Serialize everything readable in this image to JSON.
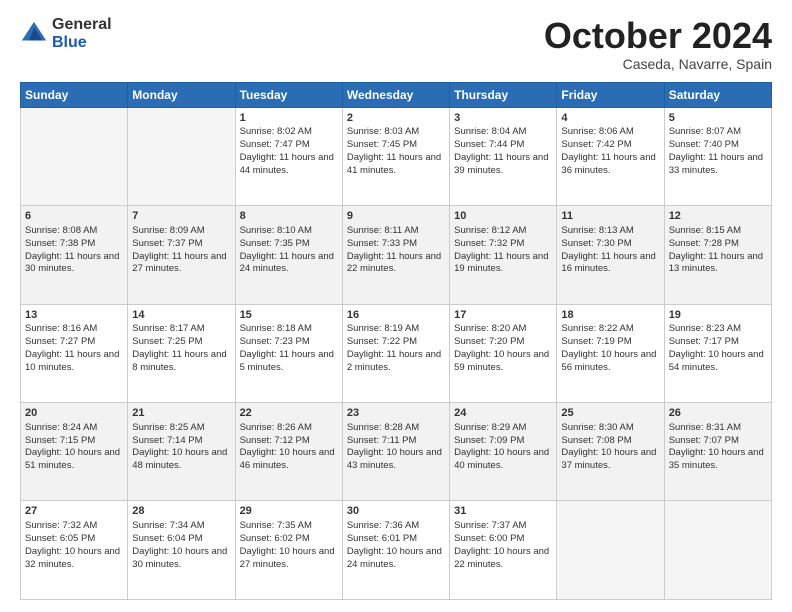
{
  "header": {
    "logo_general": "General",
    "logo_blue": "Blue",
    "month_title": "October 2024",
    "location": "Caseda, Navarre, Spain"
  },
  "weekdays": [
    "Sunday",
    "Monday",
    "Tuesday",
    "Wednesday",
    "Thursday",
    "Friday",
    "Saturday"
  ],
  "weeks": [
    [
      {
        "day": "",
        "sunrise": "",
        "sunset": "",
        "daylight": ""
      },
      {
        "day": "",
        "sunrise": "",
        "sunset": "",
        "daylight": ""
      },
      {
        "day": "1",
        "sunrise": "Sunrise: 8:02 AM",
        "sunset": "Sunset: 7:47 PM",
        "daylight": "Daylight: 11 hours and 44 minutes."
      },
      {
        "day": "2",
        "sunrise": "Sunrise: 8:03 AM",
        "sunset": "Sunset: 7:45 PM",
        "daylight": "Daylight: 11 hours and 41 minutes."
      },
      {
        "day": "3",
        "sunrise": "Sunrise: 8:04 AM",
        "sunset": "Sunset: 7:44 PM",
        "daylight": "Daylight: 11 hours and 39 minutes."
      },
      {
        "day": "4",
        "sunrise": "Sunrise: 8:06 AM",
        "sunset": "Sunset: 7:42 PM",
        "daylight": "Daylight: 11 hours and 36 minutes."
      },
      {
        "day": "5",
        "sunrise": "Sunrise: 8:07 AM",
        "sunset": "Sunset: 7:40 PM",
        "daylight": "Daylight: 11 hours and 33 minutes."
      }
    ],
    [
      {
        "day": "6",
        "sunrise": "Sunrise: 8:08 AM",
        "sunset": "Sunset: 7:38 PM",
        "daylight": "Daylight: 11 hours and 30 minutes."
      },
      {
        "day": "7",
        "sunrise": "Sunrise: 8:09 AM",
        "sunset": "Sunset: 7:37 PM",
        "daylight": "Daylight: 11 hours and 27 minutes."
      },
      {
        "day": "8",
        "sunrise": "Sunrise: 8:10 AM",
        "sunset": "Sunset: 7:35 PM",
        "daylight": "Daylight: 11 hours and 24 minutes."
      },
      {
        "day": "9",
        "sunrise": "Sunrise: 8:11 AM",
        "sunset": "Sunset: 7:33 PM",
        "daylight": "Daylight: 11 hours and 22 minutes."
      },
      {
        "day": "10",
        "sunrise": "Sunrise: 8:12 AM",
        "sunset": "Sunset: 7:32 PM",
        "daylight": "Daylight: 11 hours and 19 minutes."
      },
      {
        "day": "11",
        "sunrise": "Sunrise: 8:13 AM",
        "sunset": "Sunset: 7:30 PM",
        "daylight": "Daylight: 11 hours and 16 minutes."
      },
      {
        "day": "12",
        "sunrise": "Sunrise: 8:15 AM",
        "sunset": "Sunset: 7:28 PM",
        "daylight": "Daylight: 11 hours and 13 minutes."
      }
    ],
    [
      {
        "day": "13",
        "sunrise": "Sunrise: 8:16 AM",
        "sunset": "Sunset: 7:27 PM",
        "daylight": "Daylight: 11 hours and 10 minutes."
      },
      {
        "day": "14",
        "sunrise": "Sunrise: 8:17 AM",
        "sunset": "Sunset: 7:25 PM",
        "daylight": "Daylight: 11 hours and 8 minutes."
      },
      {
        "day": "15",
        "sunrise": "Sunrise: 8:18 AM",
        "sunset": "Sunset: 7:23 PM",
        "daylight": "Daylight: 11 hours and 5 minutes."
      },
      {
        "day": "16",
        "sunrise": "Sunrise: 8:19 AM",
        "sunset": "Sunset: 7:22 PM",
        "daylight": "Daylight: 11 hours and 2 minutes."
      },
      {
        "day": "17",
        "sunrise": "Sunrise: 8:20 AM",
        "sunset": "Sunset: 7:20 PM",
        "daylight": "Daylight: 10 hours and 59 minutes."
      },
      {
        "day": "18",
        "sunrise": "Sunrise: 8:22 AM",
        "sunset": "Sunset: 7:19 PM",
        "daylight": "Daylight: 10 hours and 56 minutes."
      },
      {
        "day": "19",
        "sunrise": "Sunrise: 8:23 AM",
        "sunset": "Sunset: 7:17 PM",
        "daylight": "Daylight: 10 hours and 54 minutes."
      }
    ],
    [
      {
        "day": "20",
        "sunrise": "Sunrise: 8:24 AM",
        "sunset": "Sunset: 7:15 PM",
        "daylight": "Daylight: 10 hours and 51 minutes."
      },
      {
        "day": "21",
        "sunrise": "Sunrise: 8:25 AM",
        "sunset": "Sunset: 7:14 PM",
        "daylight": "Daylight: 10 hours and 48 minutes."
      },
      {
        "day": "22",
        "sunrise": "Sunrise: 8:26 AM",
        "sunset": "Sunset: 7:12 PM",
        "daylight": "Daylight: 10 hours and 46 minutes."
      },
      {
        "day": "23",
        "sunrise": "Sunrise: 8:28 AM",
        "sunset": "Sunset: 7:11 PM",
        "daylight": "Daylight: 10 hours and 43 minutes."
      },
      {
        "day": "24",
        "sunrise": "Sunrise: 8:29 AM",
        "sunset": "Sunset: 7:09 PM",
        "daylight": "Daylight: 10 hours and 40 minutes."
      },
      {
        "day": "25",
        "sunrise": "Sunrise: 8:30 AM",
        "sunset": "Sunset: 7:08 PM",
        "daylight": "Daylight: 10 hours and 37 minutes."
      },
      {
        "day": "26",
        "sunrise": "Sunrise: 8:31 AM",
        "sunset": "Sunset: 7:07 PM",
        "daylight": "Daylight: 10 hours and 35 minutes."
      }
    ],
    [
      {
        "day": "27",
        "sunrise": "Sunrise: 7:32 AM",
        "sunset": "Sunset: 6:05 PM",
        "daylight": "Daylight: 10 hours and 32 minutes."
      },
      {
        "day": "28",
        "sunrise": "Sunrise: 7:34 AM",
        "sunset": "Sunset: 6:04 PM",
        "daylight": "Daylight: 10 hours and 30 minutes."
      },
      {
        "day": "29",
        "sunrise": "Sunrise: 7:35 AM",
        "sunset": "Sunset: 6:02 PM",
        "daylight": "Daylight: 10 hours and 27 minutes."
      },
      {
        "day": "30",
        "sunrise": "Sunrise: 7:36 AM",
        "sunset": "Sunset: 6:01 PM",
        "daylight": "Daylight: 10 hours and 24 minutes."
      },
      {
        "day": "31",
        "sunrise": "Sunrise: 7:37 AM",
        "sunset": "Sunset: 6:00 PM",
        "daylight": "Daylight: 10 hours and 22 minutes."
      },
      {
        "day": "",
        "sunrise": "",
        "sunset": "",
        "daylight": ""
      },
      {
        "day": "",
        "sunrise": "",
        "sunset": "",
        "daylight": ""
      }
    ]
  ]
}
